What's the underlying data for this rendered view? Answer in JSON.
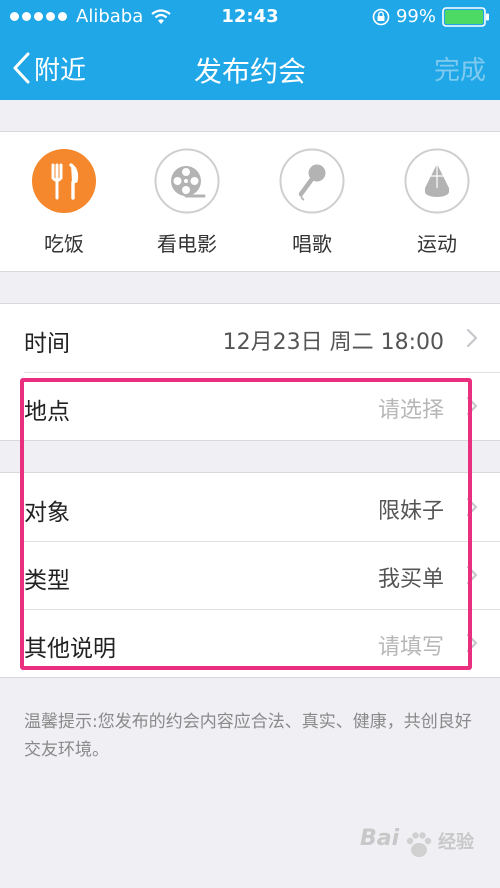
{
  "status_bar": {
    "carrier": "Alibaba",
    "time": "12:43",
    "battery": "99%",
    "signal_icon": "signal-dots-icon",
    "wifi_icon": "wifi-icon",
    "lock_icon": "rotation-lock-icon",
    "battery_icon": "battery-icon",
    "battery_color": "#4cd964"
  },
  "nav": {
    "back_label": "附近",
    "back_icon": "chevron-left-icon",
    "title": "发布约会",
    "done_label": "完成",
    "bar_color": "#1fa7e8"
  },
  "categories": [
    {
      "label": "吃饭",
      "icon": "fork-knife-icon",
      "selected": true,
      "color": "#f5872c"
    },
    {
      "label": "看电影",
      "icon": "film-reel-icon",
      "selected": false
    },
    {
      "label": "唱歌",
      "icon": "microphone-icon",
      "selected": false
    },
    {
      "label": "运动",
      "icon": "shuttlecock-icon",
      "selected": false
    }
  ],
  "rows_group1": [
    {
      "label": "时间",
      "value": "12月23日 周二 18:00",
      "placeholder": false
    },
    {
      "label": "地点",
      "value": "请选择",
      "placeholder": true
    }
  ],
  "rows_group2": [
    {
      "label": "对象",
      "value": "限妹子",
      "placeholder": false
    },
    {
      "label": "类型",
      "value": "我买单",
      "placeholder": false
    },
    {
      "label": "其他说明",
      "value": "请填写",
      "placeholder": true
    }
  ],
  "tip": "温馨提示:您发布的约会内容应合法、真实、健康，共创良好交友环境。",
  "highlight_color": "#ea2f7e",
  "watermark": {
    "text_left": "Bai",
    "text_right": "经验",
    "icon": "paw-icon"
  }
}
